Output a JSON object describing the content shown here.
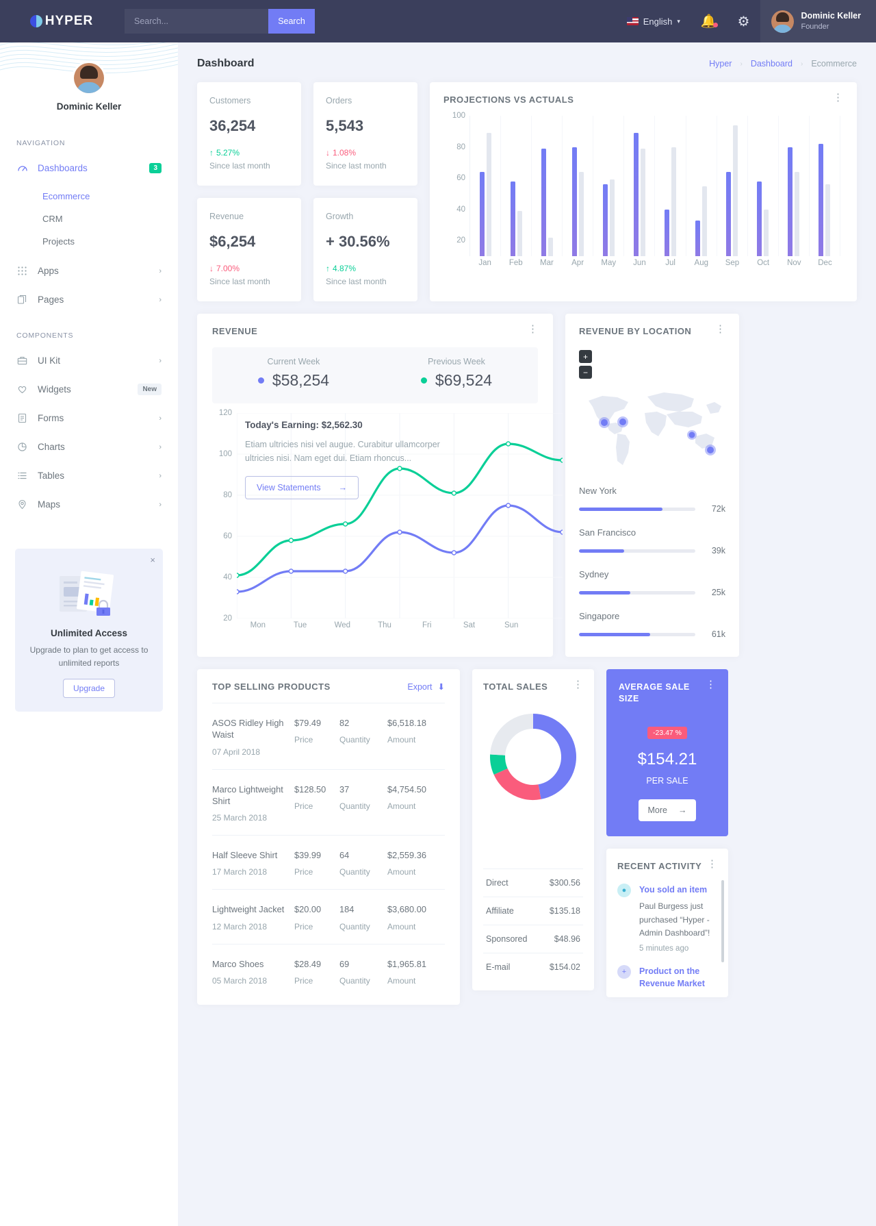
{
  "topbar": {
    "brand": "HYPER",
    "search_placeholder": "Search...",
    "search_button": "Search",
    "language": "English",
    "profile_name": "Dominic Keller",
    "profile_role": "Founder"
  },
  "sidebar": {
    "user_name": "Dominic Keller",
    "section_navigation": "NAVIGATION",
    "section_components": "COMPONENTS",
    "nav": [
      {
        "label": "Dashboards",
        "icon": "speedometer-icon",
        "badge": "3",
        "badge_type": "green",
        "active": true
      },
      {
        "label": "Apps",
        "icon": "grid-icon",
        "chevron": "›"
      },
      {
        "label": "Pages",
        "icon": "pages-icon",
        "chevron": "›"
      }
    ],
    "sub": [
      {
        "label": "Ecommerce",
        "active": true
      },
      {
        "label": "CRM",
        "active": false
      },
      {
        "label": "Projects",
        "active": false
      }
    ],
    "components": [
      {
        "label": "UI Kit",
        "icon": "briefcase-icon",
        "chevron": "›"
      },
      {
        "label": "Widgets",
        "icon": "heart-icon",
        "badge": "New",
        "badge_type": "grey"
      },
      {
        "label": "Forms",
        "icon": "form-icon",
        "chevron": "›"
      },
      {
        "label": "Charts",
        "icon": "pie-chart-icon",
        "chevron": "›"
      },
      {
        "label": "Tables",
        "icon": "list-icon",
        "chevron": "›"
      },
      {
        "label": "Maps",
        "icon": "map-pin-icon",
        "chevron": "›"
      }
    ],
    "promo": {
      "title": "Unlimited Access",
      "subtitle": "Upgrade to plan to get access to unlimited reports",
      "button": "Upgrade",
      "close": "×"
    }
  },
  "page": {
    "title": "Dashboard",
    "breadcrumb": [
      "Hyper",
      "Dashboard",
      "Ecommerce"
    ],
    "breadcrumb_sep": "›"
  },
  "stats": [
    {
      "label": "Customers",
      "value": "36,254",
      "delta": "5.27%",
      "dir": "up",
      "arrow": "↑",
      "since": "Since last month"
    },
    {
      "label": "Orders",
      "value": "5,543",
      "delta": "1.08%",
      "dir": "down",
      "arrow": "↓",
      "since": "Since last month"
    },
    {
      "label": "Revenue",
      "value": "$6,254",
      "delta": "7.00%",
      "dir": "down",
      "arrow": "↓",
      "since": "Since last month"
    },
    {
      "label": "Growth",
      "value": "+ 30.56%",
      "delta": "4.87%",
      "dir": "up",
      "arrow": "↑",
      "since": "Since last month"
    }
  ],
  "revenue_card": {
    "title": "REVENUE",
    "current_week_label": "Current Week",
    "current_week_value": "$58,254",
    "previous_week_label": "Previous Week",
    "previous_week_value": "$69,524",
    "overlay_title": "Today's Earning: $2,562.30",
    "overlay_text": "Etiam ultricies nisi vel augue. Curabitur ullamcorper ultricies nisi. Nam eget dui. Etiam rhoncus...",
    "overlay_button": "View Statements",
    "overlay_arrow": "→"
  },
  "location_card": {
    "title": "REVENUE BY LOCATION",
    "zoom_in": "+",
    "zoom_out": "−",
    "rows": [
      {
        "name": "New York",
        "value": "72k",
        "pct": 72
      },
      {
        "name": "San Francisco",
        "value": "39k",
        "pct": 39
      },
      {
        "name": "Sydney",
        "value": "25k",
        "pct": 44
      },
      {
        "name": "Singapore",
        "value": "61k",
        "pct": 61
      }
    ]
  },
  "products_card": {
    "title": "TOP SELLING PRODUCTS",
    "export_label": "Export",
    "col_price": "Price",
    "col_quantity": "Quantity",
    "col_amount": "Amount",
    "rows": [
      {
        "name": "ASOS Ridley High Waist",
        "date": "07 April 2018",
        "price": "$79.49",
        "qty": "82",
        "amount": "$6,518.18"
      },
      {
        "name": "Marco Lightweight Shirt",
        "date": "25 March 2018",
        "price": "$128.50",
        "qty": "37",
        "amount": "$4,754.50"
      },
      {
        "name": "Half Sleeve Shirt",
        "date": "17 March 2018",
        "price": "$39.99",
        "qty": "64",
        "amount": "$2,559.36"
      },
      {
        "name": "Lightweight Jacket",
        "date": "12 March 2018",
        "price": "$20.00",
        "qty": "184",
        "amount": "$3,680.00"
      },
      {
        "name": "Marco Shoes",
        "date": "05 March 2018",
        "price": "$28.49",
        "qty": "69",
        "amount": "$1,965.81"
      }
    ]
  },
  "total_sales": {
    "title": "TOTAL SALES",
    "rows": [
      {
        "label": "Direct",
        "value": "$300.56"
      },
      {
        "label": "Affiliate",
        "value": "$135.18"
      },
      {
        "label": "Sponsored",
        "value": "$48.96"
      },
      {
        "label": "E-mail",
        "value": "$154.02"
      }
    ]
  },
  "avg_sale": {
    "title": "AVERAGE SALE SIZE",
    "badge": "-23.47 %",
    "value": "$154.21",
    "per": "PER SALE",
    "button": "More",
    "button_arrow": "→"
  },
  "recent_activity": {
    "title": "RECENT ACTIVITY",
    "items": [
      {
        "icon": "dot-icon",
        "color": "cyan",
        "title": "You sold an item",
        "body": "Paul Burgess just purchased “Hyper - Admin Dashboard”!",
        "time": "5 minutes ago"
      },
      {
        "icon": "plus-icon",
        "color": "blue",
        "title": "Product on the Revenue Market",
        "body": "",
        "time": ""
      }
    ]
  },
  "chart_data": [
    {
      "type": "bar",
      "title": "PROJECTIONS VS ACTUALS",
      "categories": [
        "Jan",
        "Feb",
        "Mar",
        "Apr",
        "May",
        "Jun",
        "Jul",
        "Aug",
        "Sep",
        "Oct",
        "Nov",
        "Dec"
      ],
      "series": [
        {
          "name": "Projections",
          "color": "#727cf5",
          "values": [
            64,
            58,
            79,
            80,
            56,
            89,
            40,
            33,
            64,
            58,
            80,
            82
          ]
        },
        {
          "name": "Actuals",
          "color": "#e3e7ef",
          "values": [
            89,
            39,
            22,
            64,
            59,
            79,
            80,
            55,
            94,
            40,
            64,
            56
          ]
        }
      ],
      "ylim": [
        10,
        100
      ],
      "yticks": [
        20,
        40,
        60,
        80,
        100
      ],
      "xlabel": "",
      "ylabel": "",
      "grid": true,
      "legend": false
    },
    {
      "type": "line",
      "title": "REVENUE",
      "x": [
        "Mon",
        "Tue",
        "Wed",
        "Thu",
        "Fri",
        "Sat",
        "Sun"
      ],
      "series": [
        {
          "name": "Current Week",
          "color": "#727cf5",
          "values": [
            33,
            43,
            43,
            62,
            52,
            75,
            62
          ]
        },
        {
          "name": "Previous Week",
          "color": "#0acf97",
          "values": [
            41,
            58,
            66,
            93,
            81,
            105,
            97
          ]
        }
      ],
      "ylim": [
        20,
        120
      ],
      "yticks": [
        20,
        40,
        60,
        80,
        100,
        120
      ],
      "xlabel": "",
      "ylabel": "",
      "grid": true,
      "legend": false
    },
    {
      "type": "pie",
      "title": "TOTAL SALES",
      "labels": [
        "Direct",
        "Affiliate",
        "Sponsored",
        "E-mail"
      ],
      "values": [
        300.56,
        135.18,
        48.96,
        154.02
      ],
      "colors": [
        "#727cf5",
        "#fa5c7c",
        "#0acf97",
        "#e7eaef"
      ],
      "donut": true
    }
  ]
}
